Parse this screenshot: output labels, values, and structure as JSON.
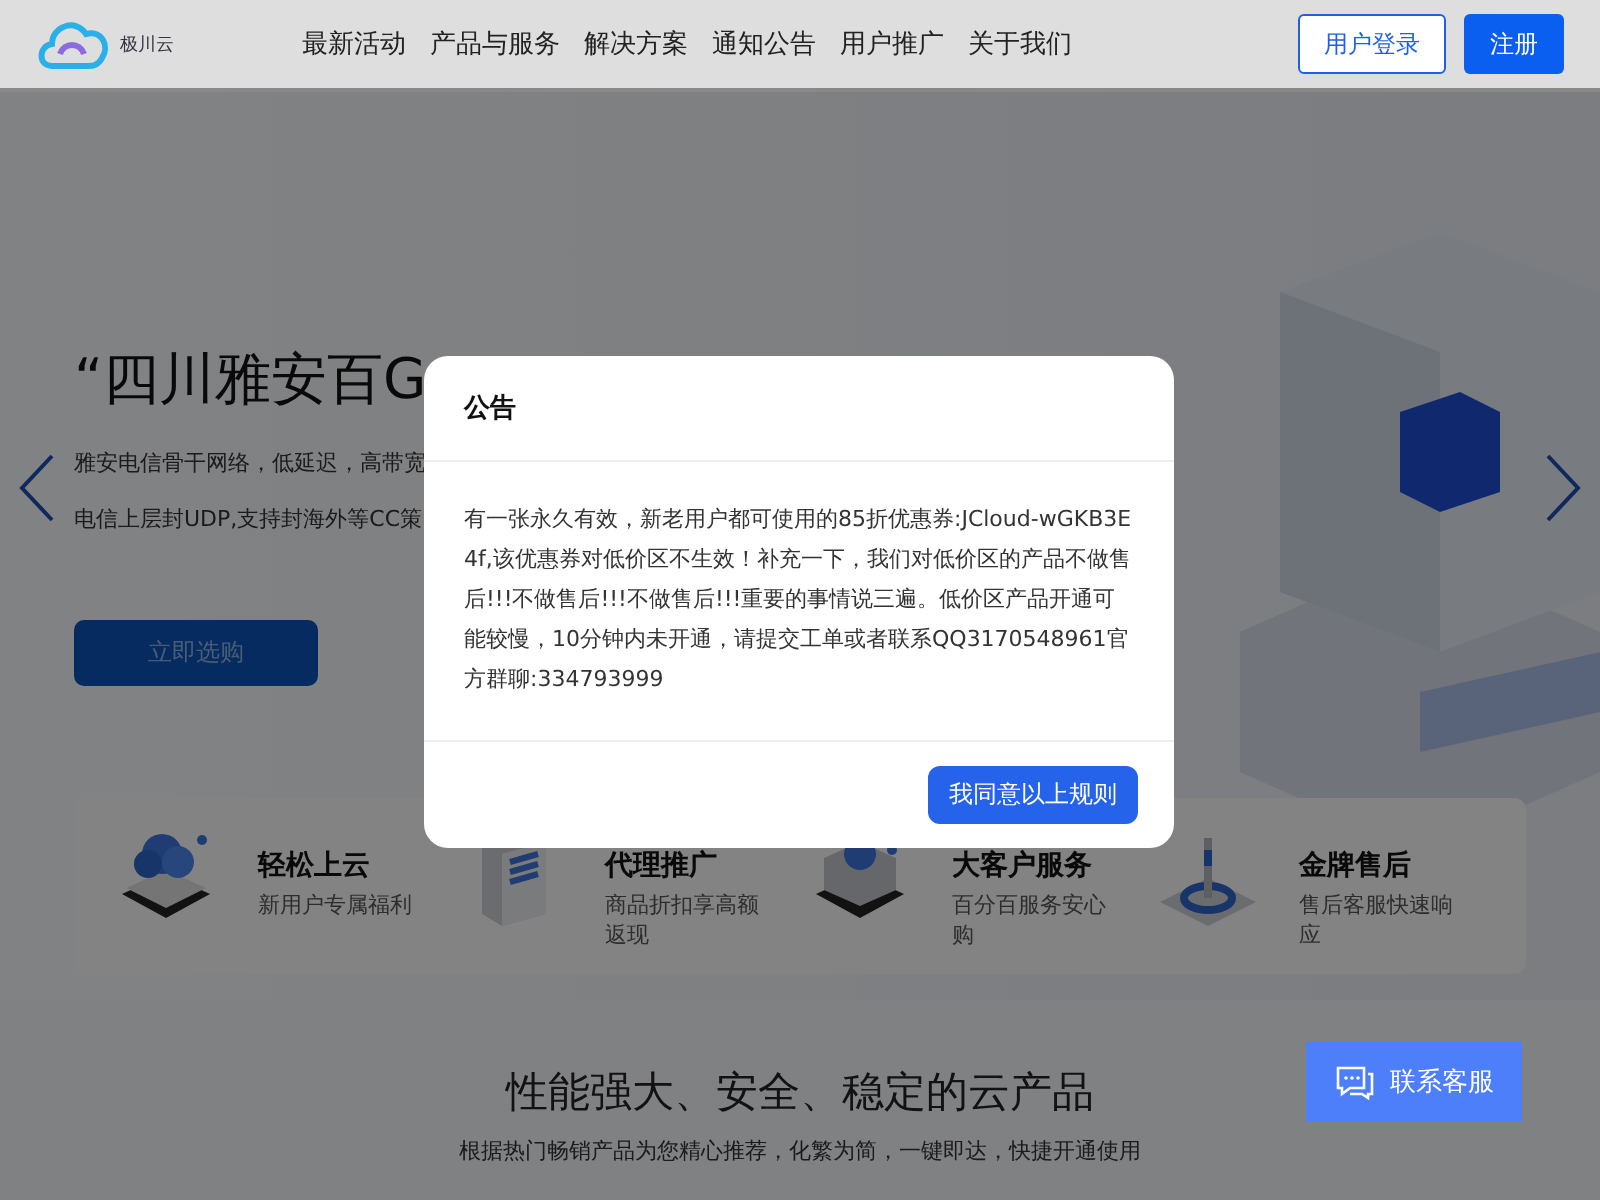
{
  "header": {
    "logo_text": "极川云",
    "nav": [
      "最新活动",
      "产品与服务",
      "解决方案",
      "通知公告",
      "用户推广",
      "关于我们"
    ],
    "login": "用户登录",
    "register": "注册"
  },
  "hero": {
    "title": "“四川雅安百G",
    "lines": [
      "雅安电信骨干网络，低延迟，高带宽",
      "电信上层封UDP,支持封海外等CC策"
    ],
    "button": "立即选购"
  },
  "features": [
    {
      "title": "轻松上云",
      "desc": "新用户专属福利"
    },
    {
      "title": "代理推广",
      "desc": "商品折扣享高额返现"
    },
    {
      "title": "大客户服务",
      "desc": "百分百服务安心购"
    },
    {
      "title": "金牌售后",
      "desc": "售后客服快速响应"
    }
  ],
  "section": {
    "title": "性能强大、安全、稳定的云产品",
    "subtitle": "根据热门畅销产品为您精心推荐，化繁为简，一键即达，快捷开通使用"
  },
  "contact_button": "联系客服",
  "modal": {
    "title": "公告",
    "body": "有一张永久有效，新老用户都可使用的85折优惠券:JCloud-wGKB3E4f,该优惠券对低价区不生效！补充一下，我们对低价区的产品不做售后!!!不做售后!!!不做售后!!!重要的事情说三遍。低价区产品开通可能较慢，10分钟内未开通，请提交工单或者联系QQ3170548961官方群聊:334793999",
    "button": "我同意以上规则"
  }
}
